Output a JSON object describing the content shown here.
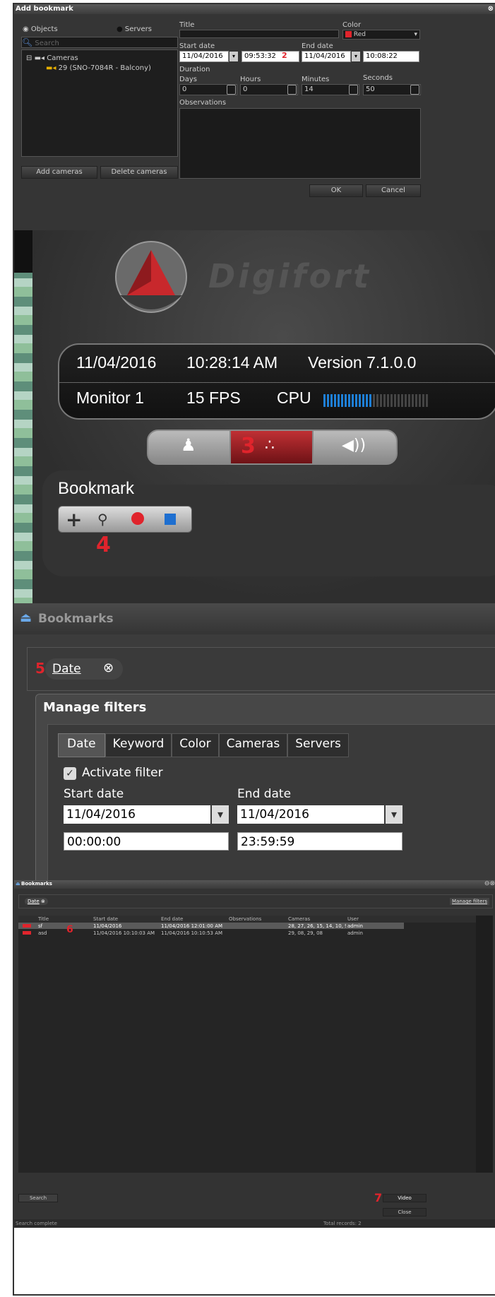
{
  "add_bookmark": {
    "title": "Add bookmark",
    "objects_label": "Objects",
    "servers_label": "Servers",
    "search_placeholder": "Search",
    "tree_root": "Cameras",
    "tree_child": "29 (SNO-7084R - Balcony)",
    "add_cameras": "Add cameras",
    "delete_cameras": "Delete cameras",
    "title_label": "Title",
    "color_label": "Color",
    "color_value": "Red",
    "start_date_label": "Start date",
    "start_date": "11/04/2016",
    "start_time": "09:53:32",
    "end_date_label": "End date",
    "end_date": "11/04/2016",
    "end_time": "10:08:22",
    "duration_label": "Duration",
    "days_label": "Days",
    "days": "0",
    "hours_label": "Hours",
    "hours": "0",
    "minutes_label": "Minutes",
    "minutes": "14",
    "seconds_label": "Seconds",
    "seconds": "50",
    "observations_label": "Observations",
    "ok": "OK",
    "cancel": "Cancel",
    "marker2": "2"
  },
  "monitor": {
    "brand": "Digifort",
    "date": "11/04/2016",
    "time": "10:28:14 AM",
    "version": "Version 7.1.0.0",
    "monitor": "Monitor 1",
    "fps": "15 FPS",
    "cpu": "CPU",
    "cpu_level": 0.45,
    "marker3": "3",
    "bookmark_label": "Bookmark",
    "marker4": "4"
  },
  "bookmarks_large": {
    "title": "Bookmarks",
    "chip": "Date",
    "marker5": "5",
    "manage_title": "Manage filters",
    "tabs": [
      "Date",
      "Keyword",
      "Color",
      "Cameras",
      "Servers"
    ],
    "activate": "Activate filter",
    "start_label": "Start date",
    "end_label": "End date",
    "start_date": "11/04/2016",
    "end_date": "11/04/2016",
    "start_time": "00:00:00",
    "end_time": "23:59:59"
  },
  "bookmarks_small": {
    "title": "Bookmarks",
    "chip": "Date",
    "manage": "Manage filters",
    "columns": [
      "Title",
      "Start date",
      "End date",
      "Observations",
      "Cameras",
      "User"
    ],
    "rows": [
      [
        "sf",
        "11/04/2016",
        "11/04/2016 12:01:00 AM",
        "",
        "28, 27, 26, 15, 14, 10, 9",
        "admin"
      ],
      [
        "asd",
        "11/04/2016 10:10:03 AM",
        "11/04/2016 10:10:53 AM",
        "",
        "29, 08, 29, 08",
        "admin"
      ]
    ],
    "marker6": "6",
    "marker7": "7",
    "search": "Search",
    "video": "Video",
    "close": "Close",
    "status": "Search complete",
    "total": "Total records: 2"
  },
  "colors": {
    "accent_red": "#e0242c",
    "cpu_blue": "#1e7fd6"
  }
}
